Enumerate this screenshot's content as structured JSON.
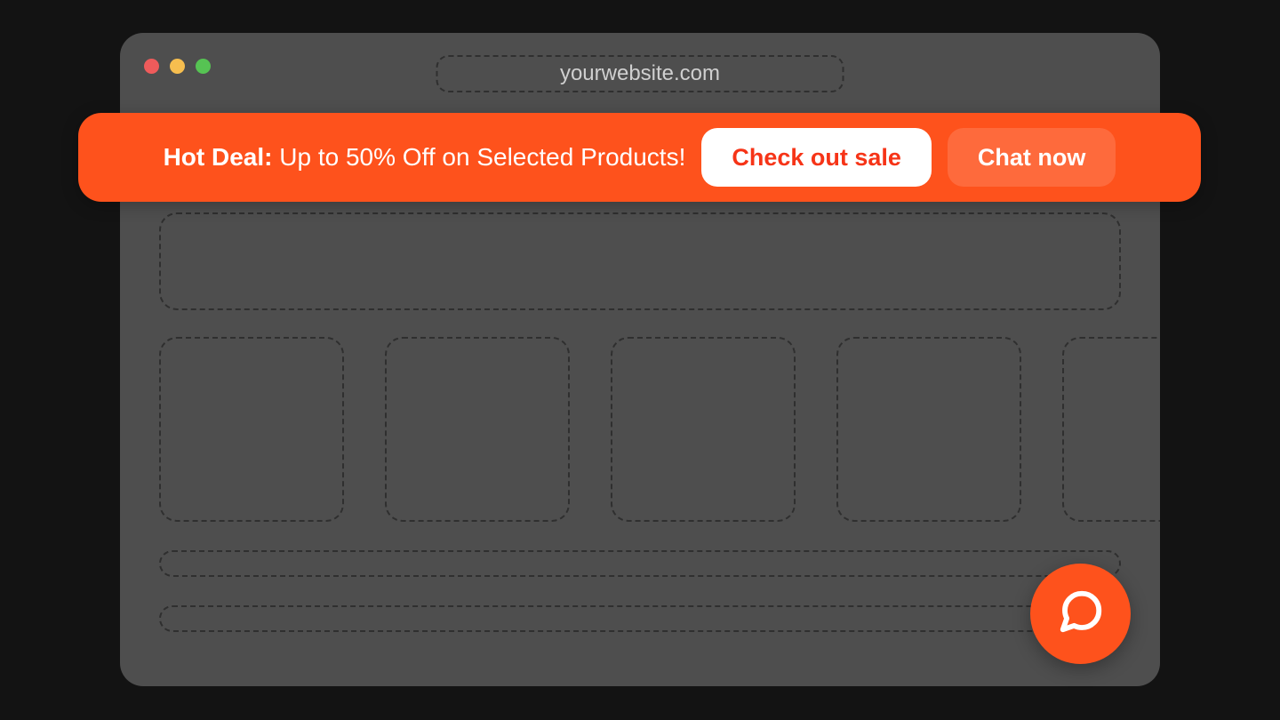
{
  "browser": {
    "url": "yourwebsite.com"
  },
  "promo": {
    "prefix": "Hot Deal:",
    "message": " Up to 50% Off on Selected Products!",
    "cta_primary": "Check out sale",
    "cta_secondary": "Chat now"
  },
  "colors": {
    "accent": "#fe521c"
  }
}
